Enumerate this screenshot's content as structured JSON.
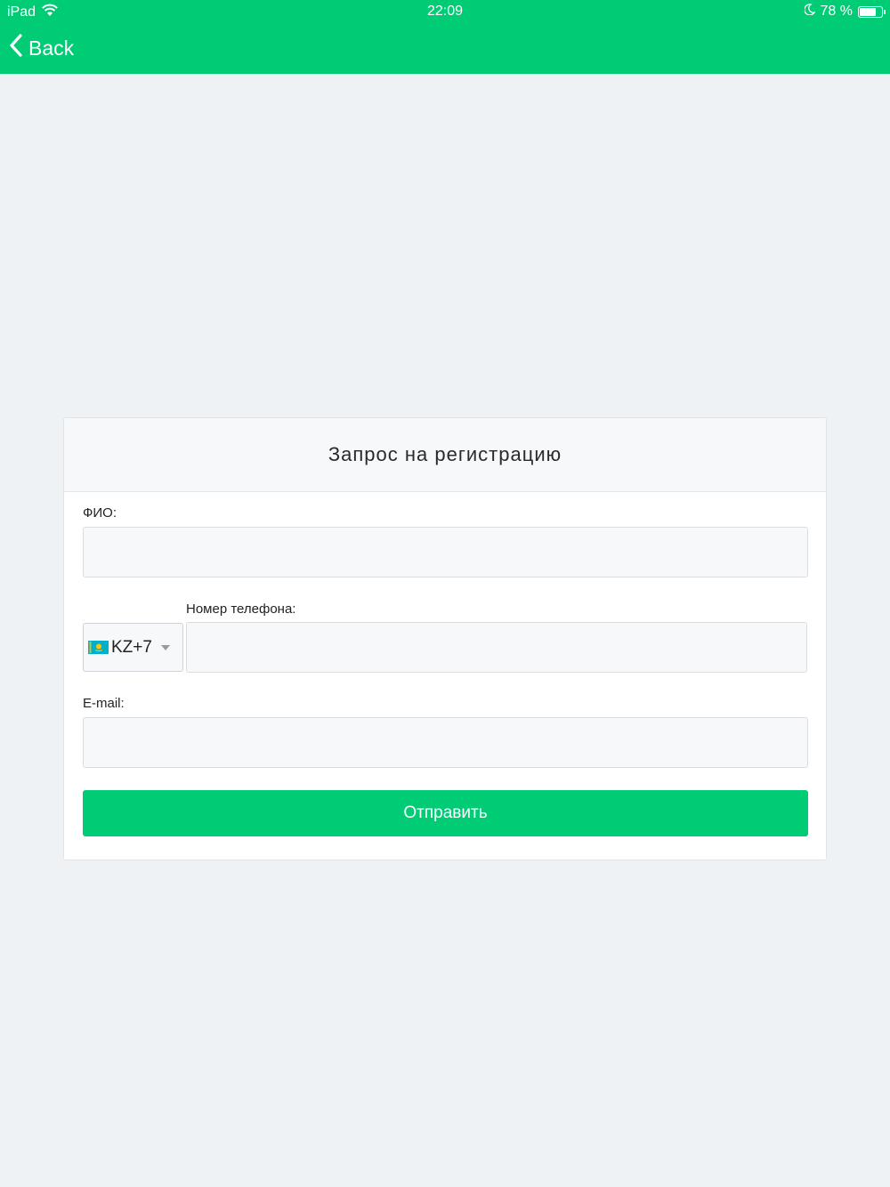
{
  "status_bar": {
    "device": "iPad",
    "time": "22:09",
    "battery": "78 %",
    "battery_level": 0.78
  },
  "nav": {
    "back_label": "Back"
  },
  "form": {
    "title": "Запрос на регистрацию",
    "name_label": "ФИО:",
    "name_value": "",
    "phone_label": "Номер телефона:",
    "country_code": "KZ+7",
    "phone_value": "",
    "email_label": "E-mail:",
    "email_value": "",
    "submit_label": "Отправить"
  },
  "colors": {
    "accent": "#00cc76",
    "background": "#eef2f5"
  }
}
